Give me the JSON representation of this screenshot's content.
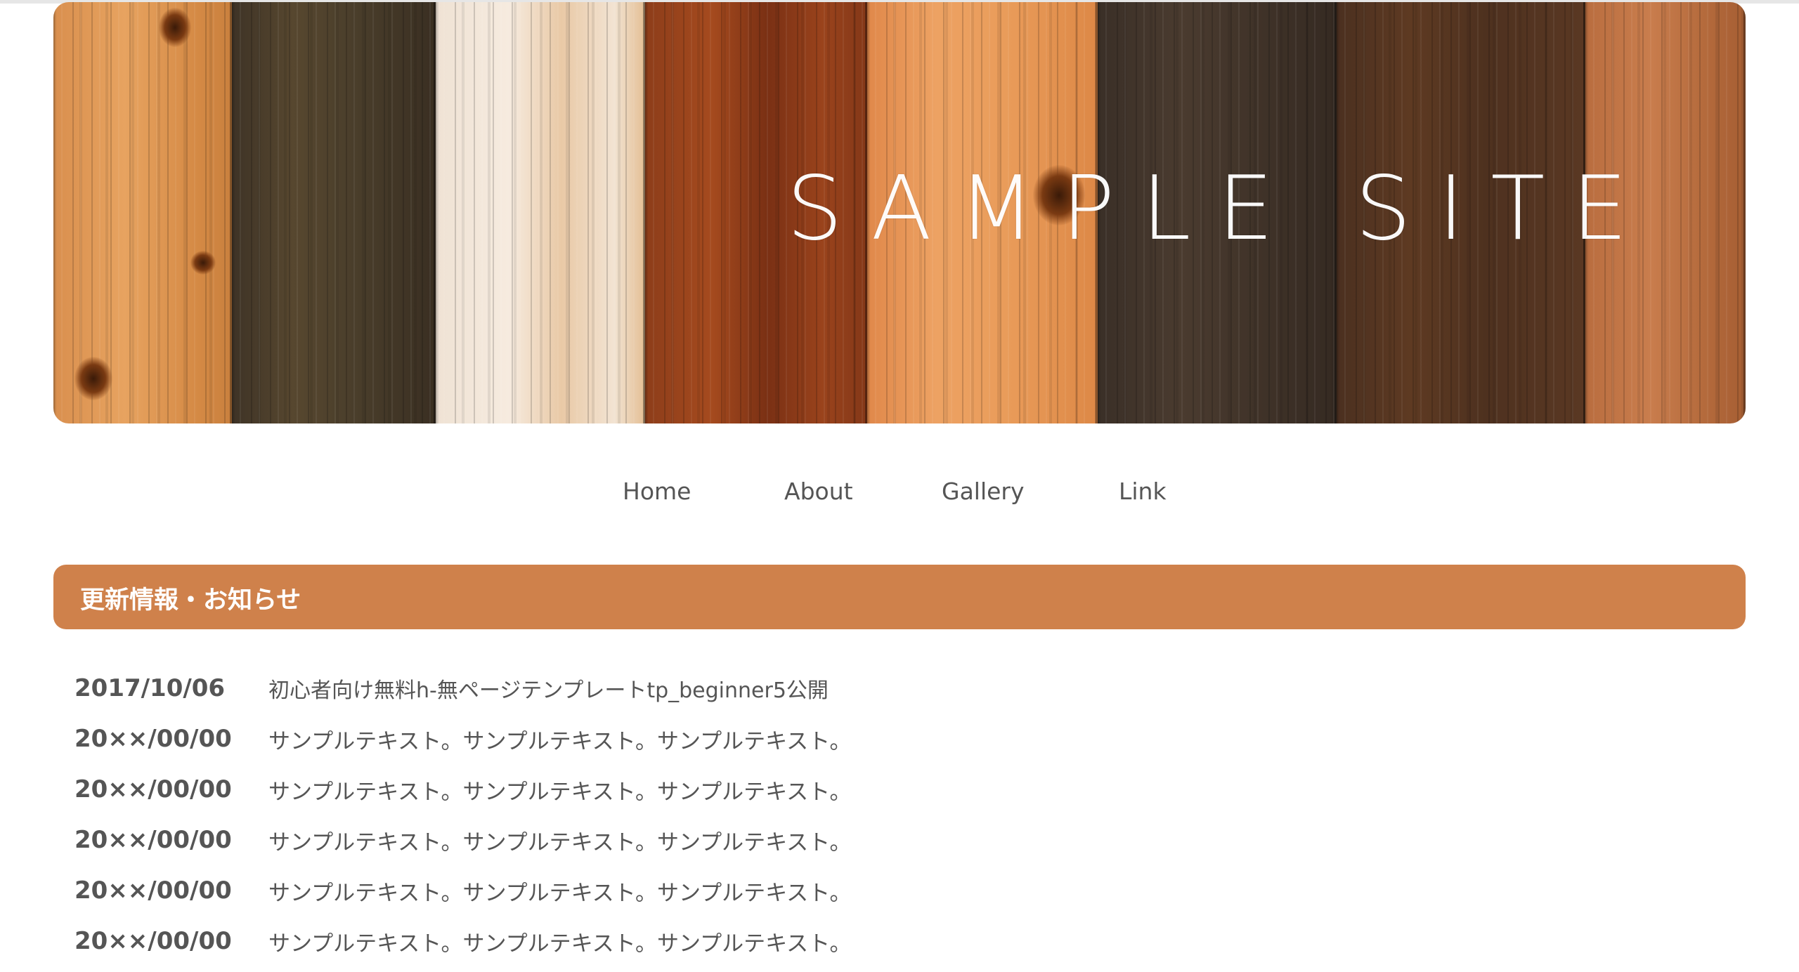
{
  "header": {
    "title": "SAMPLE SITE"
  },
  "nav": {
    "items": [
      {
        "label": "Home"
      },
      {
        "label": "About"
      },
      {
        "label": "Gallery"
      },
      {
        "label": "Link"
      }
    ]
  },
  "section": {
    "title": "更新情報・お知らせ"
  },
  "news": [
    {
      "date": "2017/10/06",
      "text": "初心者向け無料h-無ページテンプレートtp_beginner5公開"
    },
    {
      "date": "20××/00/00",
      "text": "サンプルテキスト。サンプルテキスト。サンプルテキスト。"
    },
    {
      "date": "20××/00/00",
      "text": "サンプルテキスト。サンプルテキスト。サンプルテキスト。"
    },
    {
      "date": "20××/00/00",
      "text": "サンプルテキスト。サンプルテキスト。サンプルテキスト。"
    },
    {
      "date": "20××/00/00",
      "text": "サンプルテキスト。サンプルテキスト。サンプルテキスト。"
    },
    {
      "date": "20××/00/00",
      "text": "サンプルテキスト。サンプルテキスト。サンプルテキスト。"
    }
  ],
  "colors": {
    "accent": "#cf814b",
    "text": "#555555",
    "background": "#ffffff"
  }
}
